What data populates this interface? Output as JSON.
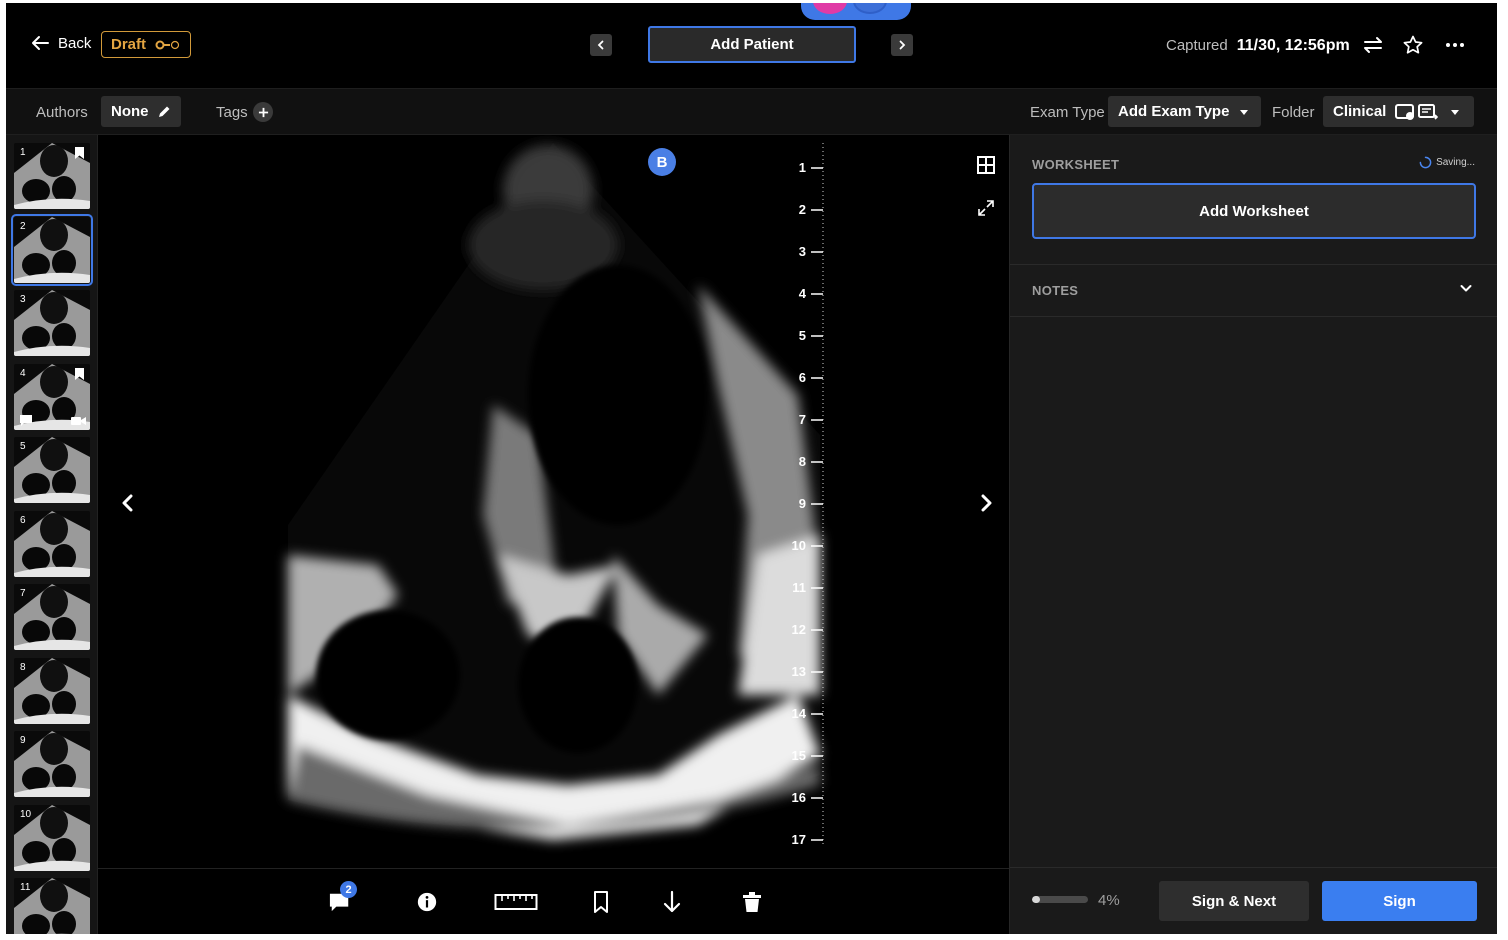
{
  "header": {
    "back_label": "Back",
    "draft_label": "Draft",
    "add_patient_label": "Add Patient",
    "captured_label": "Captured",
    "captured_value": "11/30, 12:56pm"
  },
  "meta": {
    "authors_label": "Authors",
    "authors_value": "None",
    "tags_label": "Tags",
    "exam_type_label": "Exam Type",
    "exam_type_value": "Add Exam Type",
    "folder_label": "Folder",
    "folder_value": "Clinical"
  },
  "thumbnails": [
    {
      "num": "1",
      "bookmark": true,
      "comment": false,
      "video": false,
      "active": false
    },
    {
      "num": "2",
      "bookmark": false,
      "comment": false,
      "video": false,
      "active": true
    },
    {
      "num": "3",
      "bookmark": false,
      "comment": false,
      "video": false,
      "active": false
    },
    {
      "num": "4",
      "bookmark": true,
      "comment": true,
      "video": true,
      "active": false
    },
    {
      "num": "5",
      "bookmark": false,
      "comment": false,
      "video": false,
      "active": false
    },
    {
      "num": "6",
      "bookmark": false,
      "comment": false,
      "video": false,
      "active": false
    },
    {
      "num": "7",
      "bookmark": false,
      "comment": false,
      "video": false,
      "active": false
    },
    {
      "num": "8",
      "bookmark": false,
      "comment": false,
      "video": false,
      "active": false
    },
    {
      "num": "9",
      "bookmark": false,
      "comment": false,
      "video": false,
      "active": false
    },
    {
      "num": "10",
      "bookmark": false,
      "comment": false,
      "video": false,
      "active": false
    },
    {
      "num": "11",
      "bookmark": false,
      "comment": false,
      "video": false,
      "active": false
    }
  ],
  "viewer": {
    "badge": "B",
    "ruler_labels": [
      "1",
      "2",
      "3",
      "4",
      "5",
      "6",
      "7",
      "8",
      "9",
      "10",
      "11",
      "12",
      "13",
      "14",
      "15",
      "16",
      "17"
    ]
  },
  "toolbar": {
    "comment_count": "2",
    "icons": [
      "comment-icon",
      "info-icon",
      "ruler-icon",
      "bookmark-icon",
      "download-icon",
      "trash-icon"
    ]
  },
  "panel": {
    "worksheet_title": "WORKSHEET",
    "saving_label": "Saving...",
    "add_worksheet_label": "Add Worksheet",
    "notes_title": "NOTES",
    "progress_percent": 4,
    "progress_label": "4%",
    "sign_next_label": "Sign & Next",
    "sign_label": "Sign"
  },
  "colors": {
    "accent": "#3f78e6",
    "draft": "#e3a542",
    "background": "#000000",
    "panel": "#1a1a1a"
  }
}
